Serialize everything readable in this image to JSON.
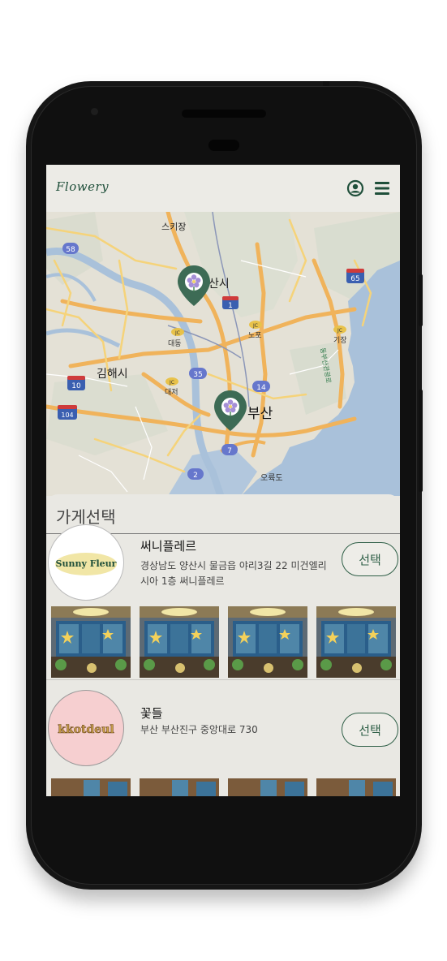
{
  "app": {
    "logo_text": "Flowery",
    "account_icon": "account-circle-icon",
    "menu_icon": "hamburger-menu-icon"
  },
  "map": {
    "labels": {
      "gijang_town": "스키장",
      "yangsan": "산시",
      "daedong": "대동",
      "nopo": "노포",
      "gijang": "기장",
      "gimhae": "김해시",
      "daejeo": "대저",
      "busan": "부산",
      "oryukdo": "오륙도",
      "coast_road": "동부산관광로"
    },
    "shields": {
      "h58": "58",
      "h65": "65",
      "h1": "1",
      "h10": "10",
      "h104": "104",
      "h35": "35",
      "h14": "14",
      "h7": "7",
      "h2": "2",
      "jc": "JC"
    },
    "marker_icon": "flower-pin-icon"
  },
  "sheet": {
    "title": "가게선택",
    "stores": [
      {
        "name": "써니플레르",
        "address": "경상남도 양산시 물금읍 야리3길 22 미건엘리시아 1층 써니플레르",
        "logo_text": "Sunny Fleur",
        "select_label": "선택"
      },
      {
        "name": "꽃들",
        "address": "부산 부산진구 중앙대로 730",
        "logo_text": "kkotdeul",
        "select_label": "선택"
      }
    ]
  },
  "colors": {
    "brand_green": "#2f5f47",
    "sheet_bg": "#e9e8e3",
    "pin_green": "#3d6b55",
    "flower_purple": "#a58fd6"
  }
}
